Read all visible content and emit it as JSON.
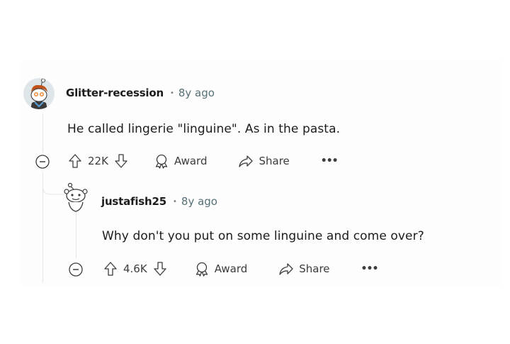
{
  "comments": [
    {
      "username": "Glitter-recession",
      "separator": "•",
      "time": "8y ago",
      "body": "He called lingerie \"linguine\". As in the pasta.",
      "score": "22K",
      "award_label": "Award",
      "share_label": "Share",
      "more_label": "•••"
    },
    {
      "username": "justafish25",
      "separator": "•",
      "time": "8y ago",
      "body": "Why don't you put on some linguine and come over?",
      "score": "4.6K",
      "award_label": "Award",
      "share_label": "Share",
      "more_label": "•••"
    }
  ],
  "colors": {
    "thread_line": "#e3e5e8",
    "text": "#1c1c1c",
    "muted": "#576f76",
    "icon": "#3c3c3c"
  }
}
